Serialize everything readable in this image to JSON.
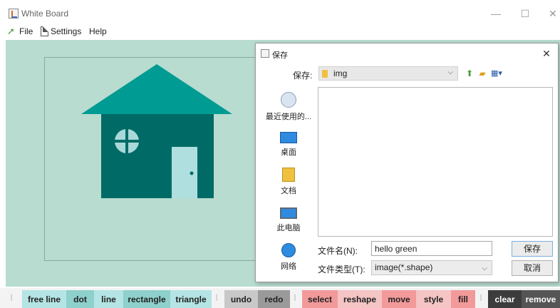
{
  "window": {
    "title": "White Board"
  },
  "menu": {
    "file": "File",
    "settings": "Settings",
    "help": "Help"
  },
  "toolbar": [
    {
      "label": "free line",
      "bg": "#b4e4e4"
    },
    {
      "label": "dot",
      "bg": "#8ed0cc"
    },
    {
      "label": "line",
      "bg": "#b4e4e4"
    },
    {
      "label": "rectangle",
      "bg": "#8ed0cc"
    },
    {
      "label": "triangle",
      "bg": "#b4e4e4"
    },
    {
      "label": "undo",
      "bg": "#c8c8c8"
    },
    {
      "label": "redo",
      "bg": "#9a9a9a"
    },
    {
      "label": "select",
      "bg": "#f29a9a"
    },
    {
      "label": "reshape",
      "bg": "#f5c4c4"
    },
    {
      "label": "move",
      "bg": "#f29a9a"
    },
    {
      "label": "style",
      "bg": "#f5c4c4"
    },
    {
      "label": "fill",
      "bg": "#f29a9a"
    },
    {
      "label": "clear",
      "bg": "#3c3c3c"
    },
    {
      "label": "remove",
      "bg": "#555555"
    }
  ],
  "canvas": {
    "background": "#b8dcd0",
    "roof_color": "#009b92",
    "wall_color": "#006b66",
    "door_color": "#b0dfe0",
    "window_color": "#a8d8d8"
  },
  "dialog": {
    "title": "保存",
    "save_in_label": "保存:",
    "folder": "img",
    "places": [
      {
        "label": "最近使用的...",
        "icon": "recent-icon"
      },
      {
        "label": "桌面",
        "icon": "desktop-icon"
      },
      {
        "label": "文档",
        "icon": "documents-icon"
      },
      {
        "label": "此电脑",
        "icon": "computer-icon"
      },
      {
        "label": "网络",
        "icon": "network-icon"
      }
    ],
    "filename_label": "文件名(N):",
    "filename_value": "hello green",
    "filetype_label": "文件类型(T):",
    "filetype_value": "image(*.shape)",
    "save_button": "保存",
    "cancel_button": "取消"
  }
}
